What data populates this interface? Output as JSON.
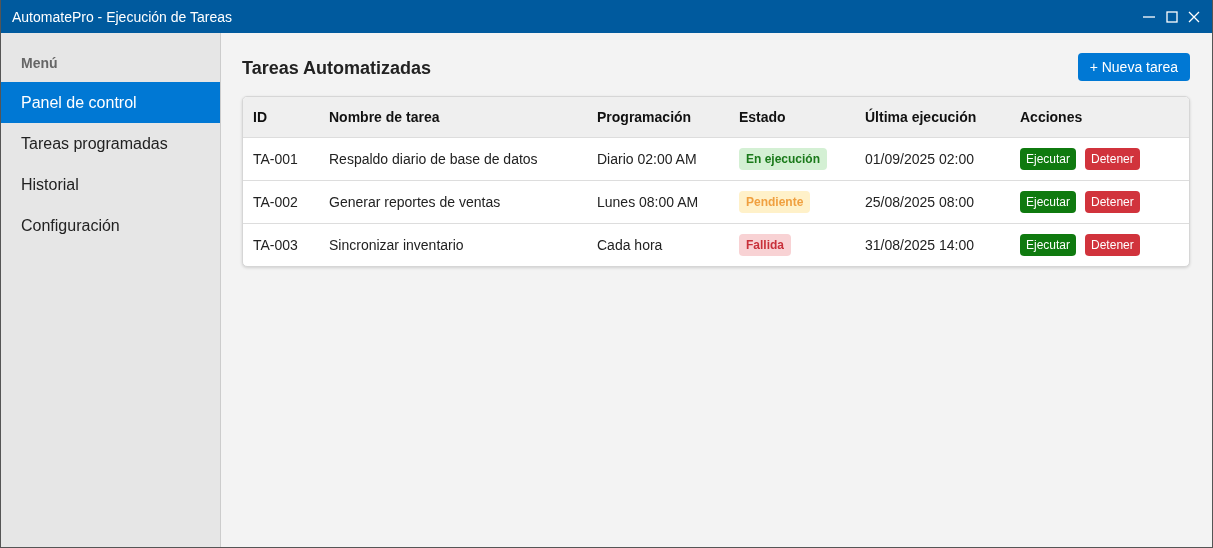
{
  "window": {
    "title": "AutomatePro - Ejecución de Tareas"
  },
  "sidebar": {
    "heading": "Menú",
    "items": [
      {
        "label": "Panel de control",
        "selected": true
      },
      {
        "label": "Tareas programadas",
        "selected": false
      },
      {
        "label": "Historial",
        "selected": false
      },
      {
        "label": "Configuración",
        "selected": false
      }
    ]
  },
  "page": {
    "title": "Tareas Automatizadas",
    "new_button": "+ Nueva tarea"
  },
  "table": {
    "columns": [
      "ID",
      "Nombre de tarea",
      "Programación",
      "Estado",
      "Última ejecución",
      "Acciones"
    ],
    "rows": [
      {
        "id": "TA-001",
        "name": "Respaldo diario de base de datos",
        "schedule": "Diario 02:00 AM",
        "status": {
          "label": "En ejecución",
          "kind": "running"
        },
        "last_run": "01/09/2025 02:00",
        "actions": [
          "Ejecutar",
          "Detener"
        ]
      },
      {
        "id": "TA-002",
        "name": "Generar reportes de ventas",
        "schedule": "Lunes 08:00 AM",
        "status": {
          "label": "Pendiente",
          "kind": "pending"
        },
        "last_run": "25/08/2025 08:00",
        "actions": [
          "Ejecutar",
          "Detener"
        ]
      },
      {
        "id": "TA-003",
        "name": "Sincronizar inventario",
        "schedule": "Cada hora",
        "status": {
          "label": "Fallida",
          "kind": "failed"
        },
        "last_run": "31/08/2025 14:00",
        "actions": [
          "Ejecutar",
          "Detener"
        ]
      }
    ]
  }
}
